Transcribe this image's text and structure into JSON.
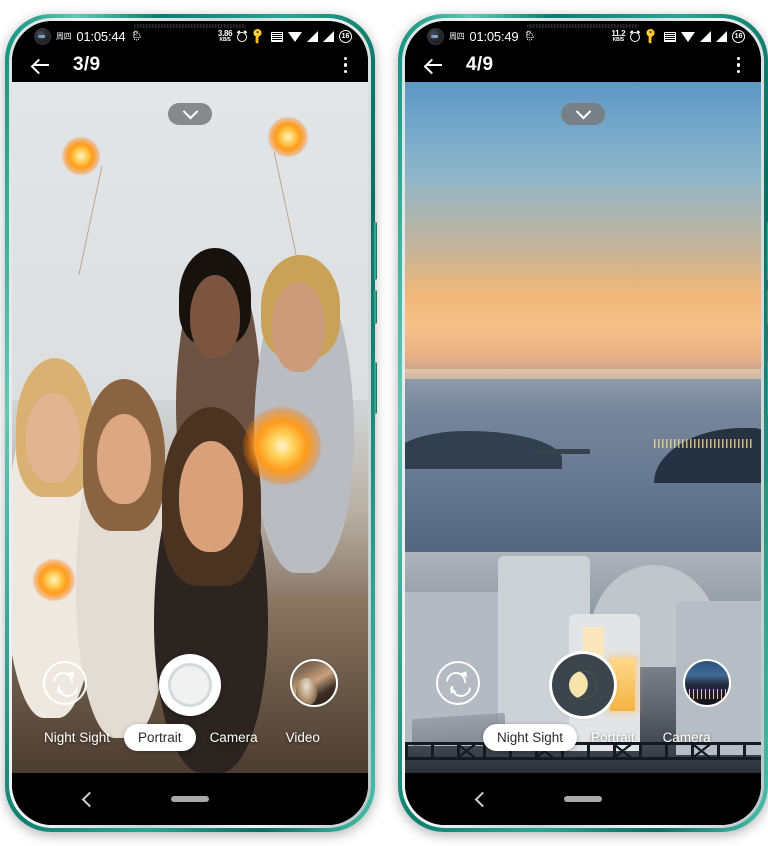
{
  "app": {
    "type": "android-camera-app-screenshot-pair",
    "frame_color": "#0c7d6d"
  },
  "phones": [
    {
      "id": "phone-left",
      "status_bar": {
        "day": "周四",
        "time": "01:05:44",
        "weather_icon": "weather-icon",
        "data_rate_value": "3.86",
        "data_rate_unit": "KB/S",
        "icons": [
          "alarm-icon",
          "vpn-key-icon",
          "volte-icon",
          "wifi-icon",
          "signal-icon",
          "signal-icon"
        ],
        "battery": "16"
      },
      "app_bar": {
        "back_icon": "back-arrow-icon",
        "pager": "3/9",
        "overflow_icon": "kebab-menu-icon"
      },
      "viewfinder": {
        "expand_icon": "chevron-down-icon",
        "scene": "group selfie with sparklers on beach"
      },
      "controls": {
        "flip_icon": "camera-flip-icon",
        "shutter_label": "shutter-button",
        "shutter_style": "photo",
        "thumbnail_label": "last-photo-thumbnail"
      },
      "modes": [
        {
          "label": "Night Sight",
          "active": false
        },
        {
          "label": "Portrait",
          "active": true
        },
        {
          "label": "Camera",
          "active": false
        },
        {
          "label": "Video",
          "active": false
        }
      ],
      "nav_bar": {
        "back_icon": "nav-back-icon",
        "home_icon": "nav-home-pill"
      }
    },
    {
      "id": "phone-right",
      "status_bar": {
        "day": "周四",
        "time": "01:05:49",
        "weather_icon": "weather-icon",
        "data_rate_value": "11.2",
        "data_rate_unit": "KB/S",
        "icons": [
          "alarm-icon",
          "vpn-key-icon",
          "volte-icon",
          "wifi-icon",
          "signal-icon",
          "signal-icon"
        ],
        "battery": "16"
      },
      "app_bar": {
        "back_icon": "back-arrow-icon",
        "pager": "4/9",
        "overflow_icon": "kebab-menu-icon"
      },
      "viewfinder": {
        "expand_icon": "chevron-down-icon",
        "scene": "santorini sunset seascape with white buildings"
      },
      "controls": {
        "flip_icon": "camera-flip-icon",
        "shutter_label": "shutter-button",
        "shutter_style": "night",
        "thumbnail_label": "last-photo-thumbnail"
      },
      "modes": [
        {
          "label": "Night Sight",
          "active": true
        },
        {
          "label": "Portrait",
          "active": false
        },
        {
          "label": "Camera",
          "active": false
        }
      ],
      "nav_bar": {
        "back_icon": "nav-back-icon",
        "home_icon": "nav-home-pill"
      }
    }
  ]
}
